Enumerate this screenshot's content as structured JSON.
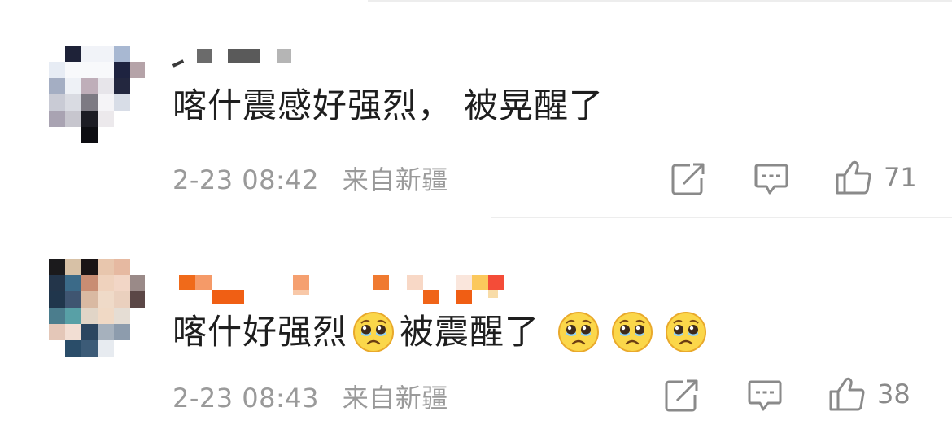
{
  "comments": [
    {
      "text_parts": [
        "喀什震感好强烈，",
        "被晃醒了"
      ],
      "time": "2-23 08:42",
      "location": "来自新疆",
      "likes": "71"
    },
    {
      "text_parts": [
        "喀什好强烈",
        "被震醒了"
      ],
      "emoji_name": "pleading-face-emoji",
      "time": "2-23 08:43",
      "location": "来自新疆",
      "likes": "38"
    }
  ],
  "icons": {
    "repost": "repost-icon",
    "comment": "comment-icon",
    "like": "thumbs-up-icon"
  },
  "colors": {
    "text": "#1e1e1e",
    "meta": "#9a9a9a",
    "icon": "#8a8a8a",
    "divider": "#ededed"
  }
}
